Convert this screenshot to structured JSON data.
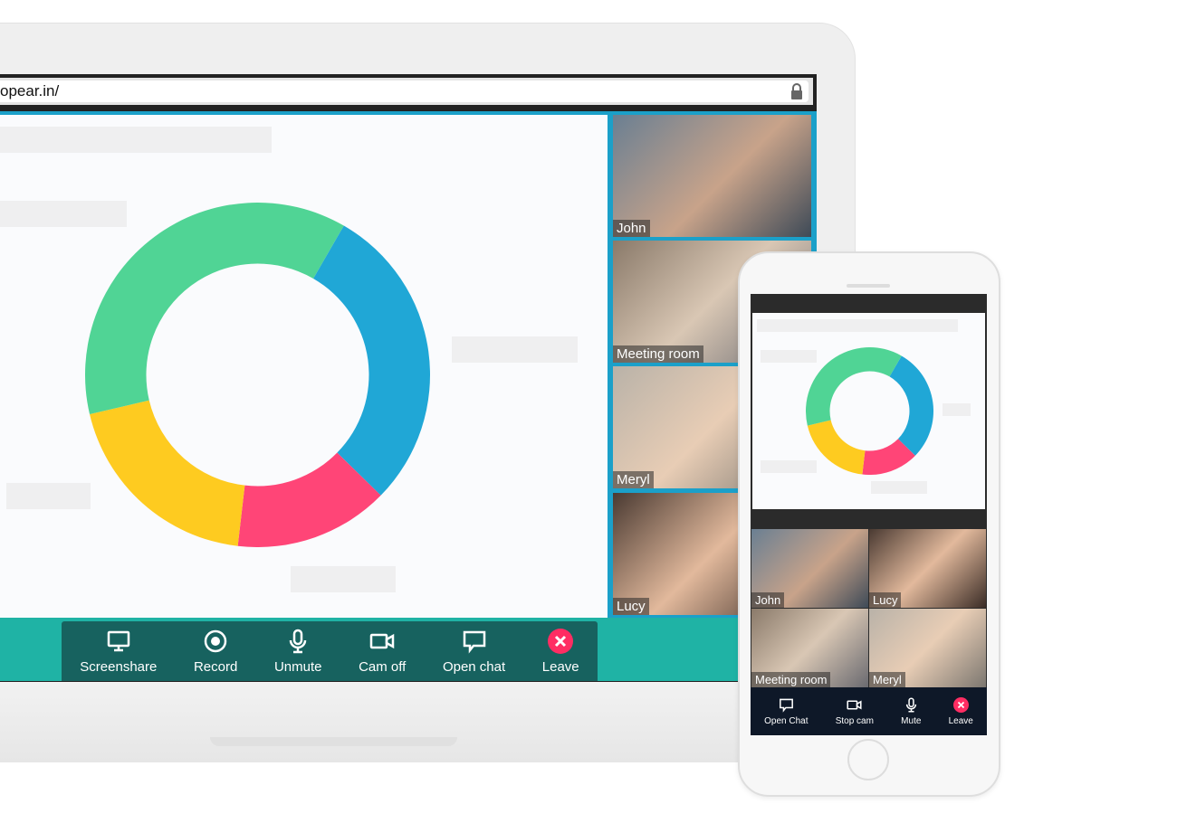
{
  "browser": {
    "url": "opear.in/",
    "icons": {
      "lock": "lock-icon"
    }
  },
  "donut": {
    "segments": [
      {
        "color": "#20a7d6",
        "value": 29
      },
      {
        "color": "#ff4577",
        "value": 14.5
      },
      {
        "color": "#fecb20",
        "value": 19.5
      },
      {
        "color": "#50d495",
        "value": 37
      }
    ]
  },
  "participants": [
    {
      "name": "John"
    },
    {
      "name": "Meeting room"
    },
    {
      "name": "Meryl"
    },
    {
      "name": "Lucy"
    }
  ],
  "toolbar": {
    "items": [
      {
        "label": "Screenshare",
        "icon": "monitor-icon"
      },
      {
        "label": "Record",
        "icon": "record-icon"
      },
      {
        "label": "Unmute",
        "icon": "microphone-icon"
      },
      {
        "label": "Cam off",
        "icon": "camera-icon"
      },
      {
        "label": "Open chat",
        "icon": "chat-icon"
      },
      {
        "label": "Leave",
        "icon": "close-icon"
      }
    ]
  },
  "phone": {
    "participants": [
      {
        "name": "John"
      },
      {
        "name": "Lucy"
      },
      {
        "name": "Meeting room"
      },
      {
        "name": "Meryl"
      }
    ],
    "toolbar": {
      "items": [
        {
          "label": "Open Chat",
          "icon": "chat-icon"
        },
        {
          "label": "Stop cam",
          "icon": "camera-icon"
        },
        {
          "label": "Mute",
          "icon": "microphone-icon"
        },
        {
          "label": "Leave",
          "icon": "close-icon"
        }
      ]
    }
  },
  "colors": {
    "teal": "#1fb3a5",
    "toolbar": "#17625f",
    "leave": "#ff2d63",
    "phone_toolbar": "#0e1828",
    "accent_blue": "#1ba0c9"
  }
}
